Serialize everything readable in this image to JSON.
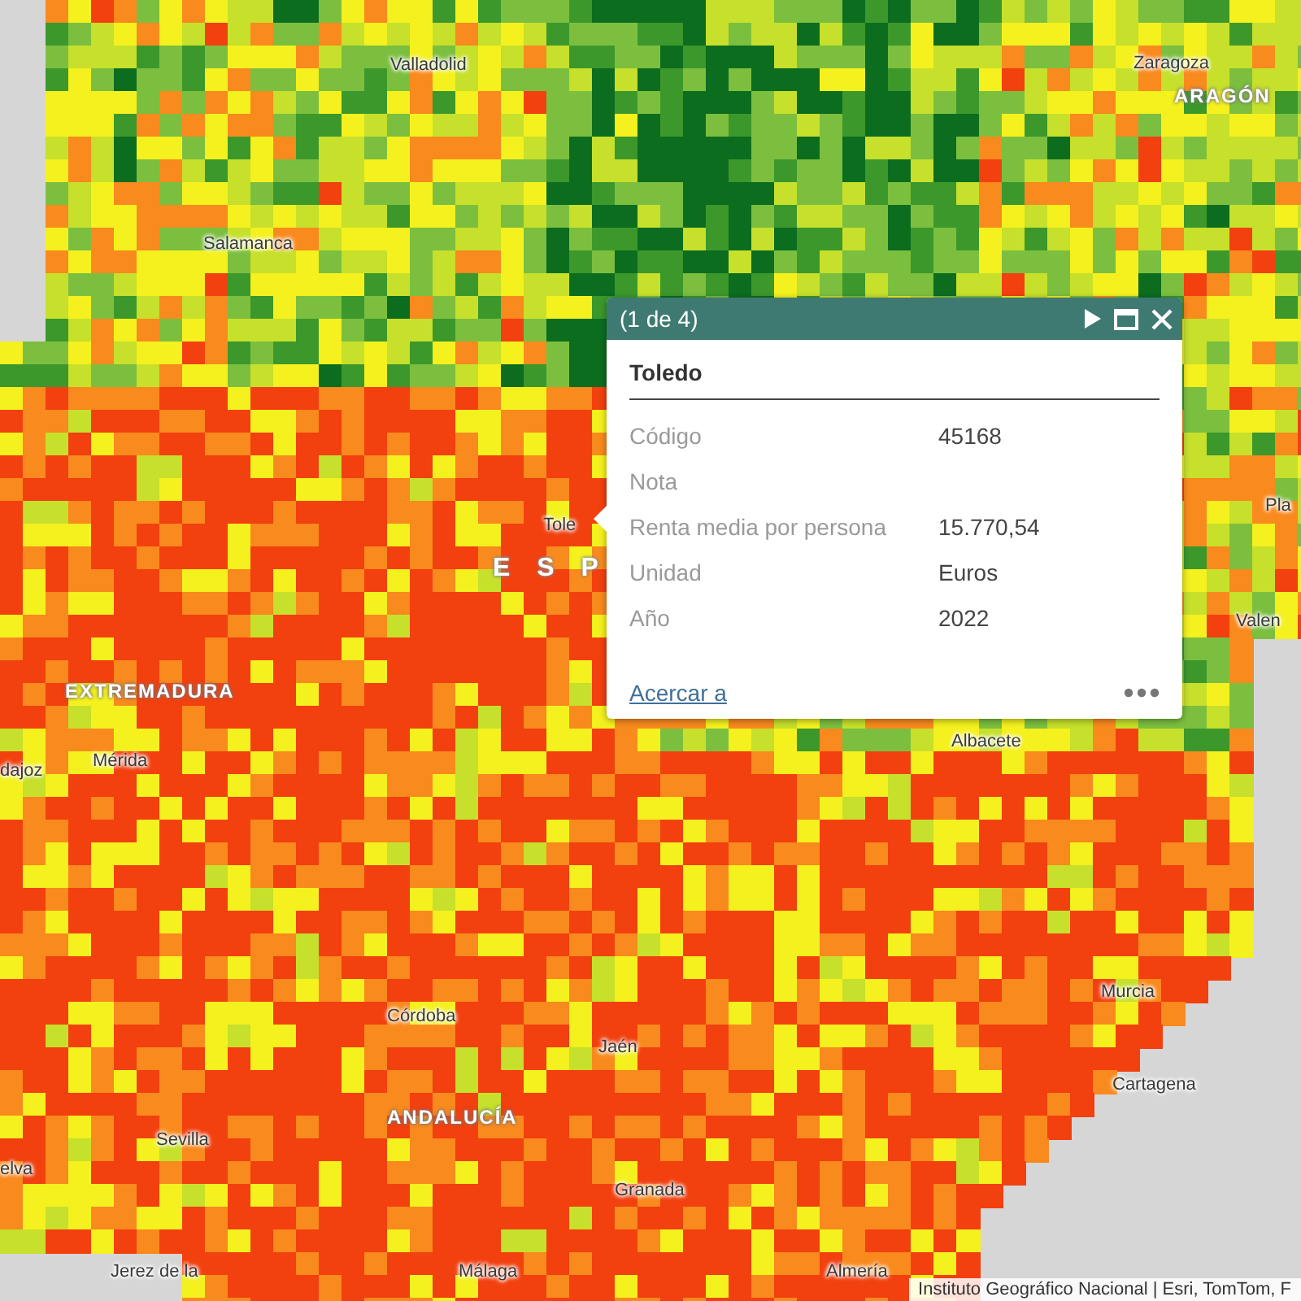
{
  "map": {
    "labels": [
      {
        "text": "Valladolid",
        "kind": "city"
      },
      {
        "text": "Zaragoza",
        "kind": "city"
      },
      {
        "text": "ARAGÓN",
        "kind": "region"
      },
      {
        "text": "Salamanca",
        "kind": "city"
      },
      {
        "text": "Tole",
        "kind": "city"
      },
      {
        "text": "E S P",
        "kind": "country"
      },
      {
        "text": "EXTREMADURA",
        "kind": "region"
      },
      {
        "text": "dajoz",
        "kind": "city"
      },
      {
        "text": "Mérida",
        "kind": "city"
      },
      {
        "text": "Albacete",
        "kind": "city"
      },
      {
        "text": "Pla",
        "kind": "city"
      },
      {
        "text": "Valen",
        "kind": "city"
      },
      {
        "text": "Córdoba",
        "kind": "city"
      },
      {
        "text": "Jaén",
        "kind": "city"
      },
      {
        "text": "Murcia",
        "kind": "city"
      },
      {
        "text": "ANDALUCÍA",
        "kind": "region"
      },
      {
        "text": "Cartagena",
        "kind": "city"
      },
      {
        "text": "Sevilla",
        "kind": "city"
      },
      {
        "text": "elva",
        "kind": "city"
      },
      {
        "text": "Granada",
        "kind": "city"
      },
      {
        "text": "Jerez de la",
        "kind": "city"
      },
      {
        "text": "Málaga",
        "kind": "city"
      },
      {
        "text": "Almería",
        "kind": "city"
      }
    ]
  },
  "popup": {
    "pager": "(1 de 4)",
    "title": "Toledo",
    "fields": [
      {
        "label": "Código",
        "value": "45168"
      },
      {
        "label": "Nota"
      },
      {
        "label": "Renta media por persona",
        "value": "15.770,54"
      },
      {
        "label": "Unidad",
        "value": "Euros"
      },
      {
        "label": "Año",
        "value": "2022"
      }
    ],
    "zoom_link": "Acercar a"
  },
  "attribution": "Instituto Geográfico Nacional | Esri, TomTom, F"
}
